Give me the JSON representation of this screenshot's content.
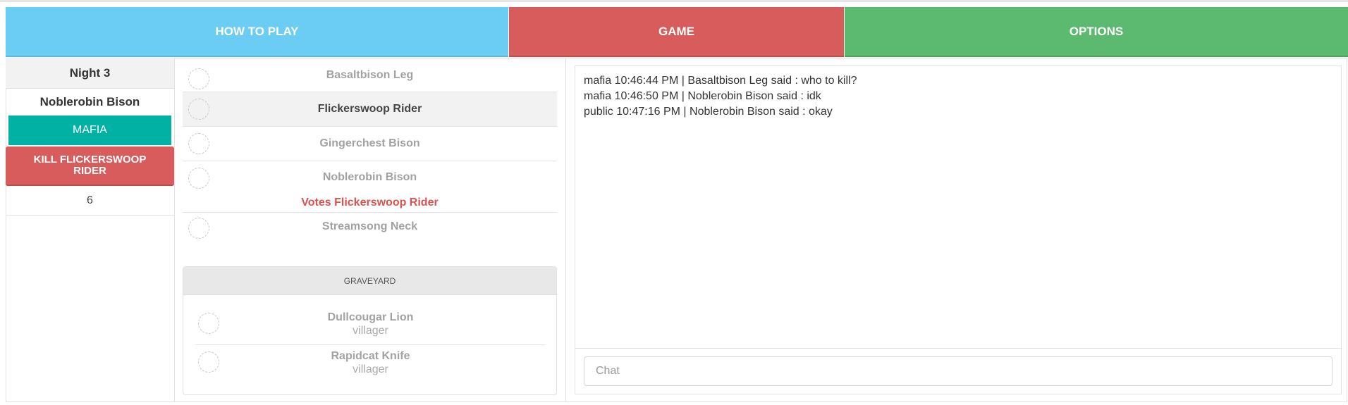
{
  "nav": {
    "how_to_play": "HOW TO PLAY",
    "game": "GAME",
    "options": "OPTIONS"
  },
  "status": {
    "night": "Night 3",
    "player": "Noblerobin Bison",
    "role": "MAFIA",
    "action": "KILL FLICKERSWOOP RIDER",
    "count": "6"
  },
  "players": [
    {
      "name": "Basaltbison Leg"
    },
    {
      "name": "Flickerswoop Rider"
    },
    {
      "name": "Gingerchest Bison"
    },
    {
      "name": "Noblerobin Bison",
      "vote": "Votes Flickerswoop Rider"
    },
    {
      "name": "Streamsong Neck"
    }
  ],
  "graveyard": {
    "title": "GRAVEYARD",
    "entries": [
      {
        "name": "Dullcougar Lion",
        "role": "villager"
      },
      {
        "name": "Rapidcat Knife",
        "role": "villager"
      }
    ]
  },
  "chat": {
    "messages": [
      "mafia 10:46:44 PM | Basaltbison Leg said : who to kill?",
      "mafia 10:46:50 PM | Noblerobin Bison said : idk",
      "public 10:47:16 PM | Noblerobin Bison said : okay"
    ],
    "placeholder": "Chat"
  }
}
